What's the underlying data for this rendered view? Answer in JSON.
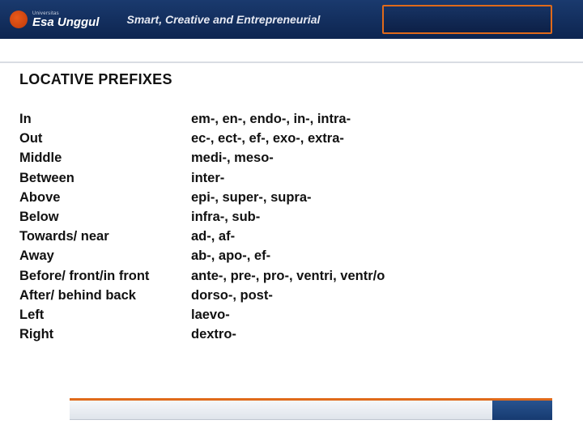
{
  "brand": {
    "univ_label": "Universitas",
    "name": "Esa Unggul",
    "tagline": "Smart, Creative and Entrepreneurial"
  },
  "title": "LOCATIVE PREFIXES",
  "rows": [
    {
      "term": "In",
      "prefixes": "em-, en-, endo-, in-, intra-"
    },
    {
      "term": "Out",
      "prefixes": "ec-, ect-, ef-, exo-, extra-"
    },
    {
      "term": "Middle",
      "prefixes": "medi-, meso-"
    },
    {
      "term": "Between",
      "prefixes": "inter-"
    },
    {
      "term": "Above",
      "prefixes": "epi-, super-, supra-"
    },
    {
      "term": "Below",
      "prefixes": "infra-, sub-"
    },
    {
      "term": "Towards/ near",
      "prefixes": "ad-, af-"
    },
    {
      "term": "Away",
      "prefixes": "ab-, apo-, ef-"
    },
    {
      "term": "Before/ front/in front",
      "prefixes": "ante-, pre-, pro-, ventri, ventr/o"
    },
    {
      "term": "After/ behind back",
      "prefixes": "dorso-, post-"
    },
    {
      "term": "Left",
      "prefixes": "laevo-"
    },
    {
      "term": "Right",
      "prefixes": "dextro-"
    }
  ]
}
